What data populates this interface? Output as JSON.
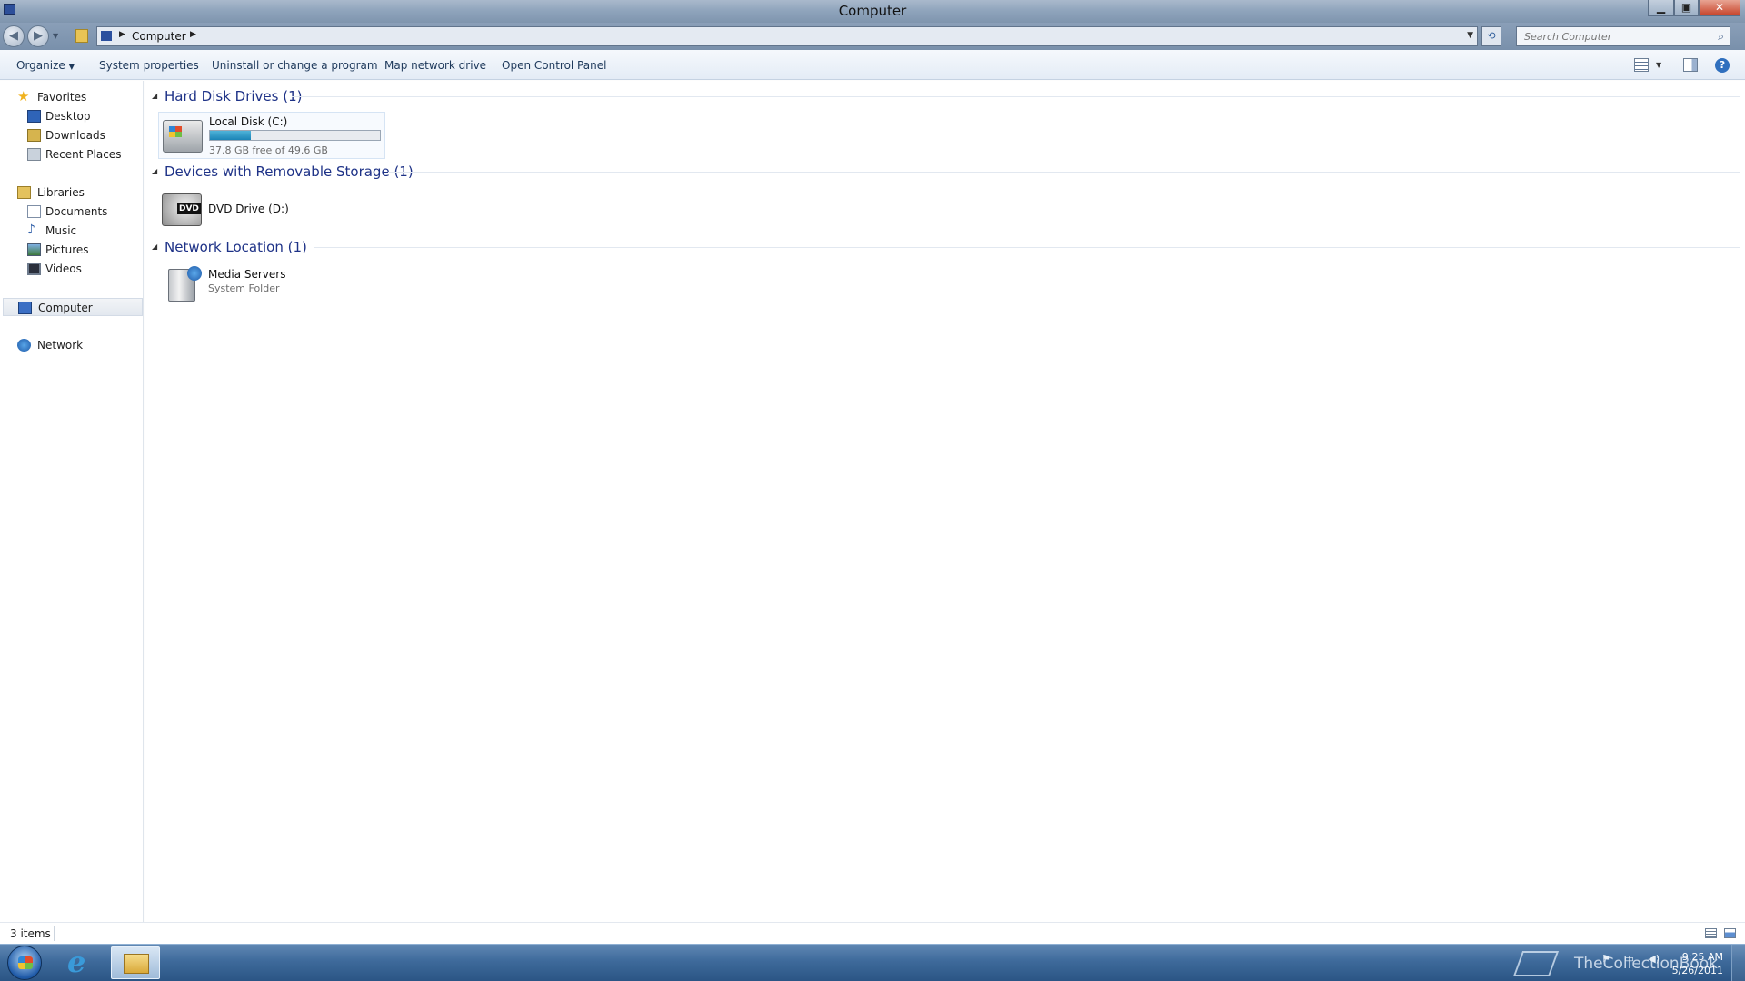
{
  "window": {
    "title": "Computer",
    "min_glyph": "▁",
    "max_glyph": "▣",
    "close_glyph": "✕"
  },
  "navigation": {
    "back_glyph": "◀",
    "forward_glyph": "▶",
    "history_glyph": "▼",
    "breadcrumb": [
      "Computer"
    ],
    "separator_glyph": "▶",
    "address_dropdown_glyph": "▼",
    "refresh_glyph": "⟲",
    "search_placeholder": "Search Computer",
    "search_glyph": "⌕"
  },
  "toolbar": {
    "organize": "Organize",
    "caret": "▼",
    "system_properties": "System properties",
    "uninstall": "Uninstall or change a program",
    "map_network_drive": "Map network drive",
    "open_control_panel": "Open Control Panel",
    "help_glyph": "?"
  },
  "sidebar": {
    "favorites": "Favorites",
    "star_glyph": "★",
    "favorites_items": [
      "Desktop",
      "Downloads",
      "Recent Places"
    ],
    "libraries": "Libraries",
    "libraries_items": [
      "Documents",
      "Music",
      "Pictures",
      "Videos"
    ],
    "music_glyph": "♪",
    "computer": "Computer",
    "network": "Network"
  },
  "groups": [
    {
      "title": "Hard Disk Drives (1)",
      "items": [
        {
          "name": "Local Disk (C:)",
          "detail": "37.8 GB free of 49.6 GB",
          "used_fraction": 0.24,
          "icon": "hard-disk-icon"
        }
      ]
    },
    {
      "title": "Devices with Removable Storage (1)",
      "items": [
        {
          "name": "DVD Drive (D:)",
          "badge": "DVD",
          "icon": "dvd-drive-icon"
        }
      ]
    },
    {
      "title": "Network Location (1)",
      "items": [
        {
          "name": "Media Servers",
          "detail": "System Folder",
          "icon": "media-server-icon"
        }
      ]
    }
  ],
  "group_collapse_glyph": "◢",
  "status": {
    "item_count": "3 items"
  },
  "taskbar": {
    "ie_glyph": "e",
    "watermark": "TheCollectionBook",
    "tray_glyphs": [
      "⚑",
      "▭",
      "◀)"
    ],
    "time": "9:25 AM",
    "date": "5/26/2011"
  },
  "colors": {
    "group_title": "#1e3287",
    "progress_fill": "#1b84b6",
    "taskbar": "#3e6a9b"
  }
}
